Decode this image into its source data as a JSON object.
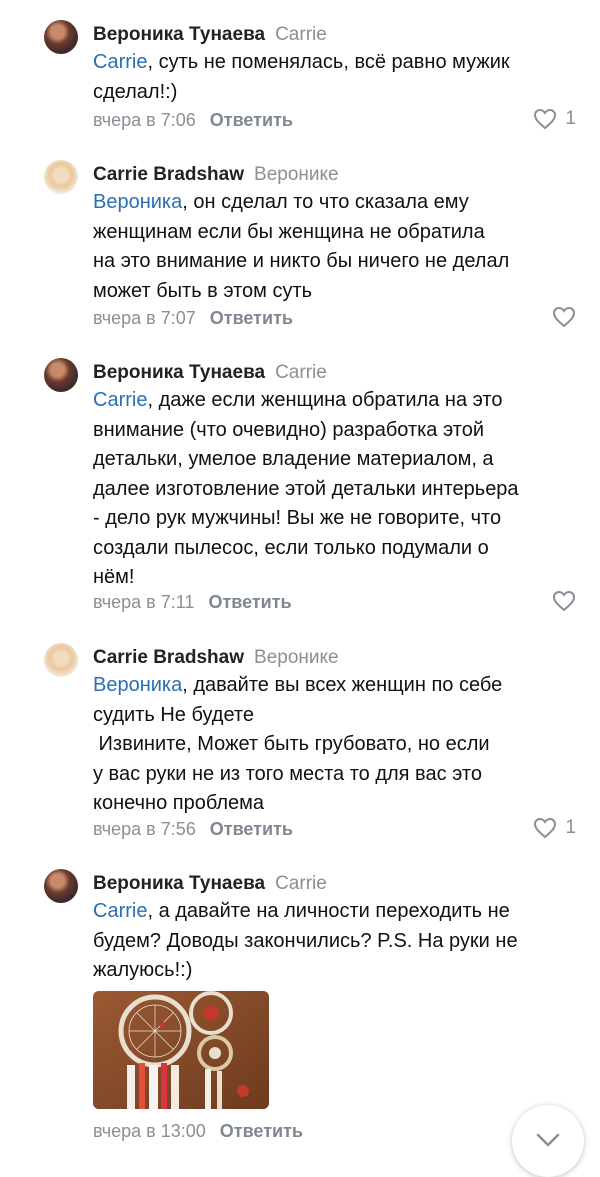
{
  "comments": [
    {
      "author": "Вероника Тунаева",
      "reply_to": "Carrie",
      "mention": "Carrie",
      "lines": [
        ", суть не поменялась, всё равно мужик",
        "сделал!:)"
      ],
      "time": "вчера в 7:06",
      "reply_label": "Ответить",
      "likes": "1"
    },
    {
      "author": "Carrie Bradshaw",
      "reply_to": "Веронике",
      "mention": "Вероника",
      "lines": [
        ", он сделал то что сказала ему",
        "женщинам если бы женщина не обратила",
        "на это внимание и никто бы ничего не делал",
        "может быть в этом суть"
      ],
      "time": "вчера в 7:07",
      "reply_label": "Ответить",
      "likes": ""
    },
    {
      "author": "Вероника Тунаева",
      "reply_to": "Carrie",
      "mention": "Carrie",
      "lines": [
        ", даже если женщина обратила на это",
        "внимание (что очевидно) разработка этой",
        "детальки, умелое владение материалом, а",
        "далее изготовление этой детальки интерьера",
        "- дело рук мужчины! Вы же не говорите, что",
        "создали пылесос, если только подумали о",
        "нём!"
      ],
      "time": "вчера в 7:11",
      "reply_label": "Ответить",
      "likes": ""
    },
    {
      "author": "Carrie Bradshaw",
      "reply_to": "Веронике",
      "mention": "Вероника",
      "lines": [
        ", давайте вы всех женщин по себе",
        "судить Не будете",
        " Извините, Может быть грубовато, но если",
        "у вас руки не из того места то для вас это",
        "конечно проблема"
      ],
      "time": "вчера в 7:56",
      "reply_label": "Ответить",
      "likes": "1"
    },
    {
      "author": "Вероника Тунаева",
      "reply_to": "Carrie",
      "mention": "Carrie",
      "lines": [
        ", а давайте на личности переходить не",
        "будем? Доводы закончились? P.S. На руки не",
        "жалуюсь!:)"
      ],
      "time": "вчера в 13:00",
      "reply_label": "Ответить",
      "likes": ""
    }
  ],
  "icons": {
    "like": "heart-outline-icon",
    "scroll": "chevron-down-icon"
  },
  "colors": {
    "mention": "#2a6fb5",
    "secondary": "#8a8f96"
  }
}
